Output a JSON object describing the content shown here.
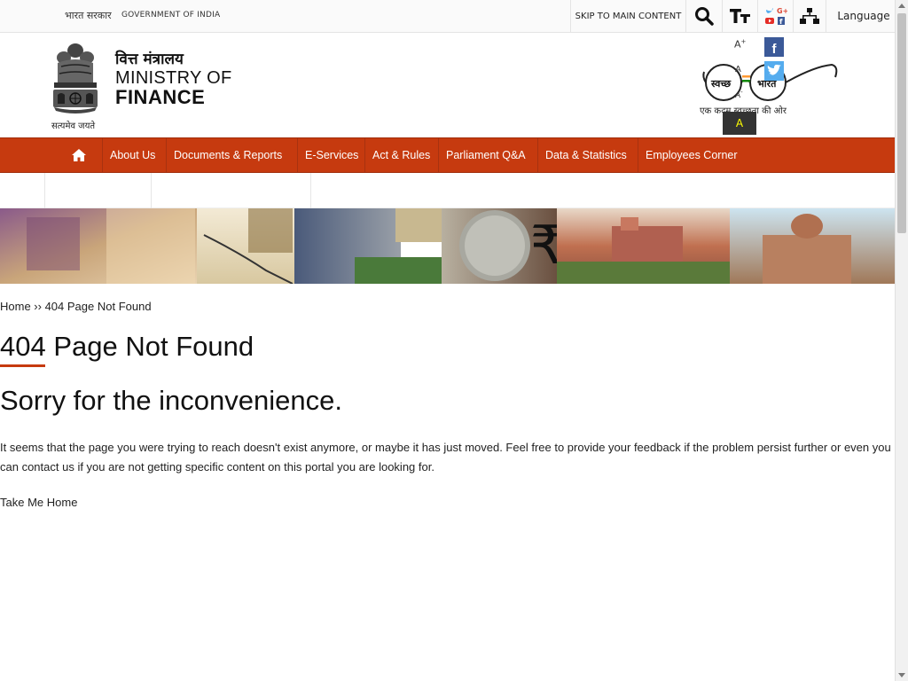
{
  "topbar": {
    "gov_hindi": "भारत सरकार",
    "gov_english": "GOVERNMENT OF INDIA",
    "skip_label": "SKIP TO MAIN CONTENT",
    "language_label": "Language",
    "icons": [
      "search-icon",
      "text-size-icon",
      "social-icon",
      "sitemap-icon"
    ]
  },
  "header": {
    "brand_hindi": "वित्त मंत्रालय",
    "brand_line1": "MINISTRY OF",
    "brand_line2": "FINANCE",
    "motto": "सत्यमेव जयते",
    "font_increase": "A",
    "font_increase_sup": "+",
    "font_normal": "A",
    "font_decrease": "A",
    "font_decrease_sup": "-",
    "contrast_label": "A",
    "swachh_left": "स्वच्छ",
    "swachh_right": "भारत",
    "swachh_tagline": "एक कदम स्वच्छता की ओर",
    "facebook_glyph": "f"
  },
  "nav": {
    "home_icon": "home-icon",
    "items": [
      {
        "label": "About Us"
      },
      {
        "label": "Documents & Reports"
      },
      {
        "label": "E-Services"
      },
      {
        "label": "Act & Rules"
      },
      {
        "label": "Parliament Q&A"
      },
      {
        "label": "Data & Statistics"
      },
      {
        "label": "Employees Corner"
      }
    ]
  },
  "breadcrumb": {
    "home": "Home",
    "separator": " ›› ",
    "current": "404 Page Not Found"
  },
  "content": {
    "title": "404 Page Not Found",
    "subtitle": "Sorry for the inconvenience.",
    "message": "It seems that the page you were trying to reach doesn't exist anymore, or maybe it has just moved. Feel free to provide your feedback if the problem persist further or even you can contact us if you are not getting specific content on this portal you are looking for.",
    "take_home": "Take Me Home"
  },
  "colors": {
    "accent": "#c63a0f",
    "facebook": "#3b5998",
    "twitter": "#55acee"
  }
}
